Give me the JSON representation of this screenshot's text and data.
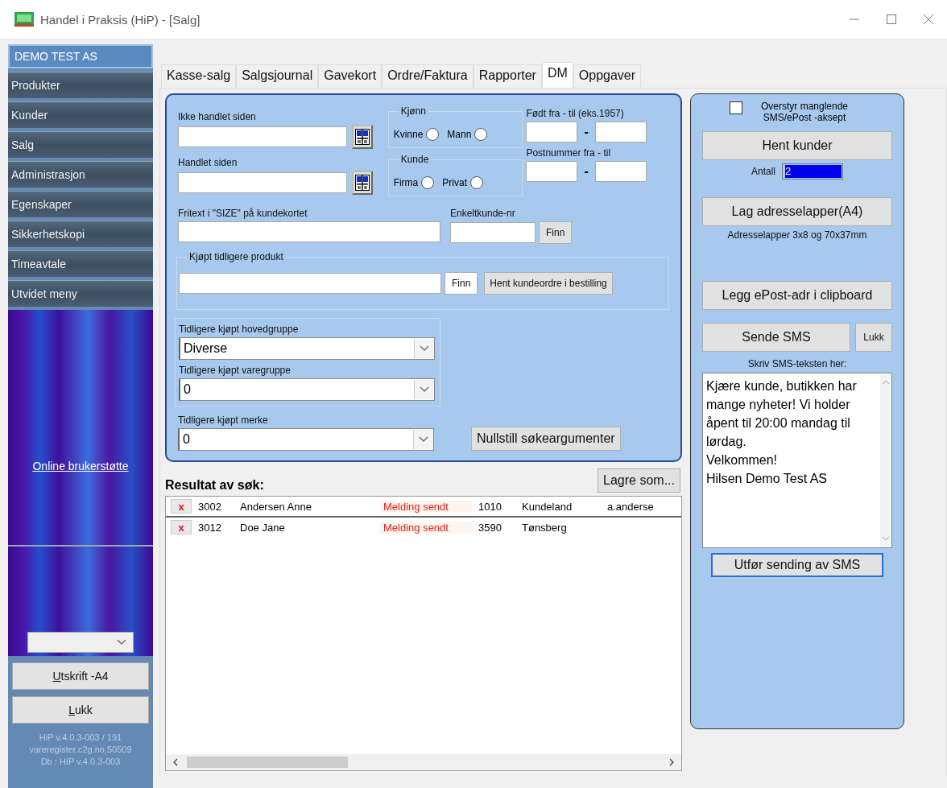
{
  "window": {
    "title": "Handel i Praksis (HiP) - [Salg]"
  },
  "sidebar": {
    "company": "DEMO TEST AS",
    "items": [
      "Produkter",
      "Kunder",
      "Salg",
      "Administrasjon",
      "Egenskaper",
      "Sikkerhetskopi",
      "Timeavtale",
      "Utvidet meny"
    ],
    "support_link": "Online brukerstøtte",
    "buttons": [
      "Utskrift -A4",
      "Lukk"
    ],
    "version_lines": [
      "HiP v.4.0.3-003 / 191",
      "vareregister.c2g.no,50509",
      "Db : HIP v.4.0.3-003"
    ]
  },
  "tabs": [
    {
      "label": "Kasse-salg",
      "selected": false
    },
    {
      "label": "Salgsjournal",
      "selected": false
    },
    {
      "label": "Gavekort",
      "selected": false
    },
    {
      "label": "Ordre/Faktura",
      "selected": false
    },
    {
      "label": "Rapporter",
      "selected": false
    },
    {
      "label": "DM",
      "selected": true
    },
    {
      "label": "Oppgaver",
      "selected": false
    }
  ],
  "filters": {
    "date_fields": [
      {
        "label": "Ikke handlet siden"
      },
      {
        "label": "Handlet siden"
      }
    ],
    "radio_groups": [
      {
        "legend": "Kjønn",
        "options": [
          {
            "label": "Kvinne",
            "selected": false
          },
          {
            "label": "Mann",
            "selected": false
          }
        ]
      },
      {
        "legend": "Kunde",
        "options": [
          {
            "label": "Firma",
            "selected": false
          },
          {
            "label": "Privat",
            "selected": false
          }
        ]
      }
    ],
    "ranges": [
      {
        "label": "Født fra - til (eks.1957)",
        "separator": "-"
      },
      {
        "label": "Postnummer fra - til",
        "separator": "-"
      }
    ],
    "free_text": {
      "label": "Fritext i \"SIZE\" på kundekortet"
    },
    "customer_number": {
      "label": "Enkeltkunde-nr",
      "button": "Finn"
    },
    "product": {
      "legend": "Kjøpt tidligere produkt",
      "button": "Finn",
      "order_button": "Hent kundeordre i bestilling"
    },
    "selects": [
      {
        "label": "Tidligere kjøpt hovedgruppe",
        "value": "Diverse"
      },
      {
        "label": "Tidligere kjøpt varegruppe",
        "value": "0"
      },
      {
        "label": "Tidligere kjøpt merke",
        "value": "0"
      }
    ],
    "reset_button": "Nullstill søkeargumenter"
  },
  "results": {
    "title": "Resultat av søk:",
    "save_button": "Lagre som...",
    "rows": [
      {
        "delete": "x",
        "number": "3002",
        "name": "Andersen Anne",
        "status": "Melding sendt",
        "postcode": "1010",
        "city": "Kundeland",
        "email": "a.anderse"
      },
      {
        "delete": "x",
        "number": "3012",
        "name": "Doe Jane",
        "status": "Melding sendt",
        "postcode": "3590",
        "city": "Tønsberg"
      }
    ]
  },
  "sms_panel": {
    "override": {
      "label": "Overstyr manglende SMS/ePost -aksept",
      "checked": false
    },
    "fetch_button": "Hent kunder",
    "count_label": "Antall",
    "count_value": "2",
    "labels_button": "Lag adresselapper(A4)",
    "labels_note": "Adresselapper 3x8 og 70x37mm",
    "clipboard_button": "Legg ePost-adr i clipboard",
    "send_button": "Sende SMS",
    "close_button": "Lukk",
    "message_label": "Skriv SMS-teksten her:",
    "message": "Kjære kunde, butikken har mange nyheter! Vi holder åpent til 20:00 mandag til lørdag.\nVelkommen!\nHilsen Demo Test AS",
    "execute_button": "Utfør sending av SMS"
  }
}
